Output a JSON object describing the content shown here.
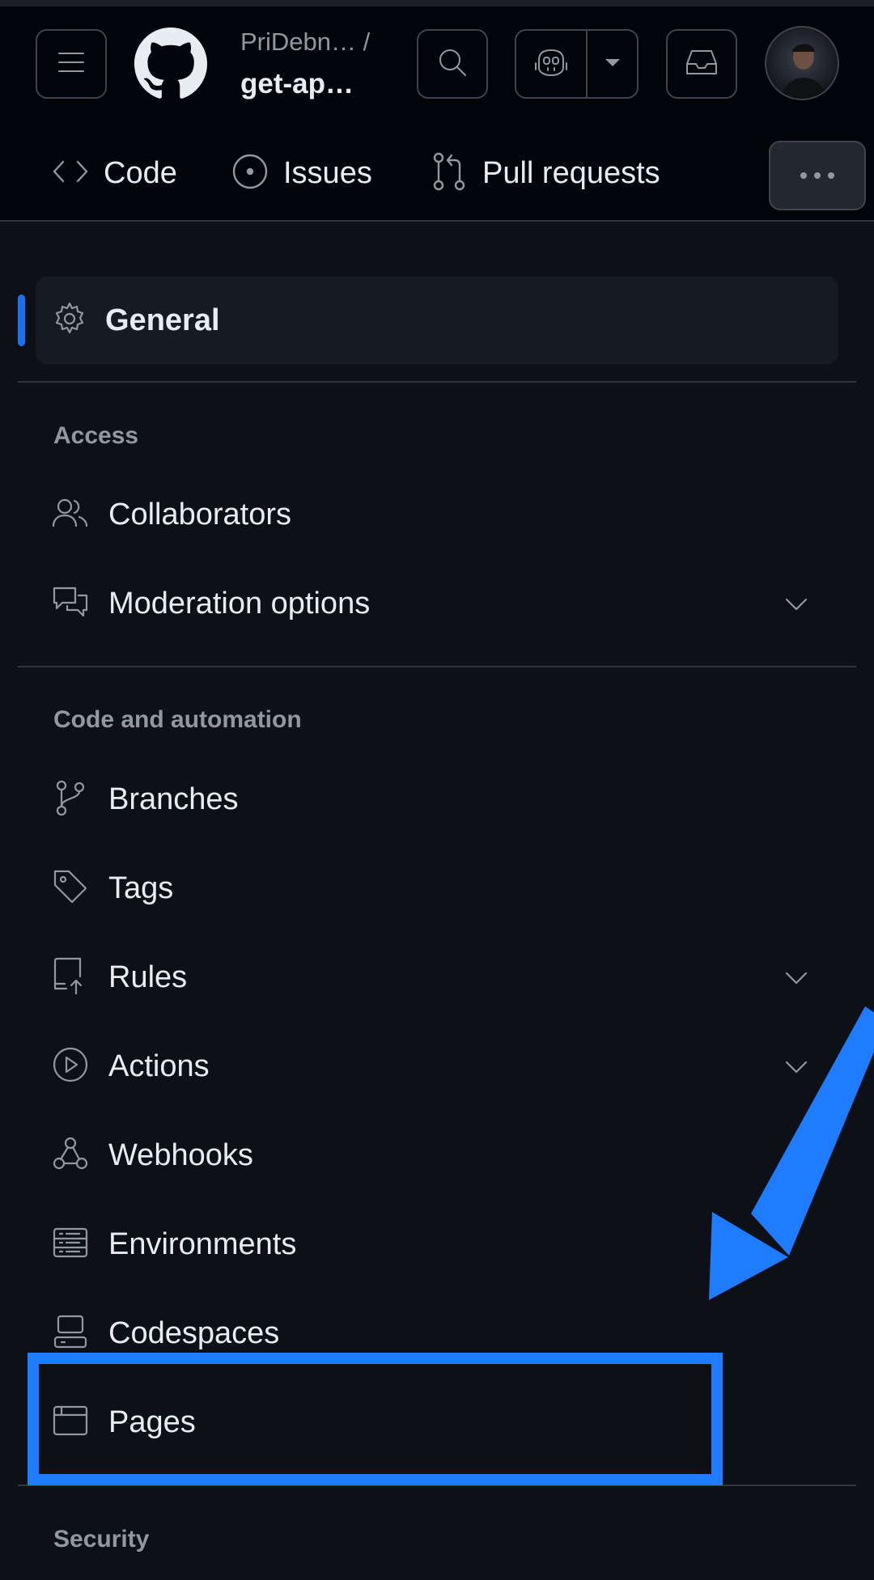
{
  "header": {
    "owner": "PriDebn… /",
    "repo": "get-ap…",
    "menu_icon": "hamburger-icon",
    "logo": "github-logo",
    "search_icon": "search-icon",
    "copilot_icon": "copilot-icon",
    "inbox_icon": "inbox-icon",
    "avatar": "user-avatar"
  },
  "tabs": [
    {
      "label": "Code",
      "icon": "code-icon"
    },
    {
      "label": "Issues",
      "icon": "issue-opened-icon"
    },
    {
      "label": "Pull requests",
      "icon": "git-pull-request-icon"
    }
  ],
  "sidebar": {
    "general": {
      "label": "General",
      "icon": "gear-icon"
    },
    "sections": [
      {
        "title": "Access",
        "items": [
          {
            "label": "Collaborators",
            "icon": "people-icon",
            "expandable": false
          },
          {
            "label": "Moderation options",
            "icon": "comment-discussion-icon",
            "expandable": true
          }
        ]
      },
      {
        "title": "Code and automation",
        "items": [
          {
            "label": "Branches",
            "icon": "git-branch-icon",
            "expandable": false
          },
          {
            "label": "Tags",
            "icon": "tag-icon",
            "expandable": false
          },
          {
            "label": "Rules",
            "icon": "repo-push-icon",
            "expandable": true
          },
          {
            "label": "Actions",
            "icon": "play-icon",
            "expandable": true
          },
          {
            "label": "Webhooks",
            "icon": "webhook-icon",
            "expandable": false
          },
          {
            "label": "Environments",
            "icon": "server-icon",
            "expandable": false
          },
          {
            "label": "Codespaces",
            "icon": "codespaces-icon",
            "expandable": false
          },
          {
            "label": "Pages",
            "icon": "browser-icon",
            "expandable": false
          }
        ]
      },
      {
        "title": "Security",
        "items": []
      }
    ]
  },
  "annotation": {
    "highlight_color": "#1f7bff",
    "target": "Pages"
  },
  "colors": {
    "background": "#0d1117",
    "header": "#010409",
    "accent": "#1f6feb"
  }
}
